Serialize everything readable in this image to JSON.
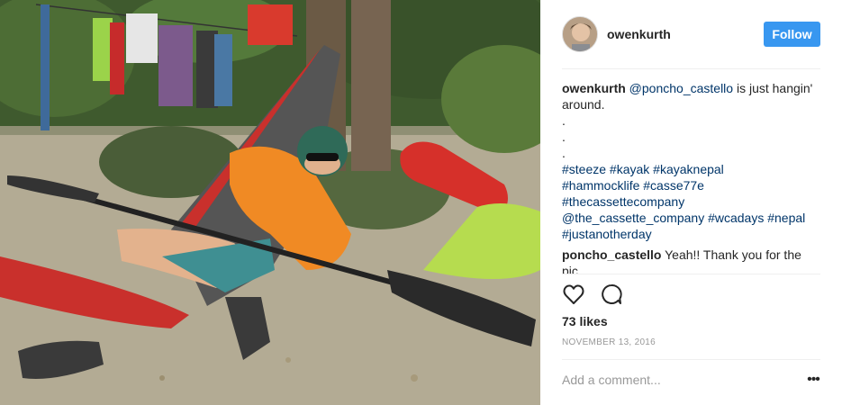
{
  "photo": {
    "description_icon": "photo-hammock-kayaker"
  },
  "header": {
    "username": "owenkurth",
    "follow_label": "Follow"
  },
  "caption": {
    "username": "owenkurth",
    "mention": "@poncho_castello",
    "text": " is just hangin' around.",
    "dots": [
      ".",
      ".",
      "."
    ],
    "hashtag_lines": [
      "#steeze #kayak #kayaknepal",
      "#hammocklife #casse77e",
      "#thecassettecompany",
      "@the_cassette_company #wcadays #nepal",
      "#justanotherday"
    ]
  },
  "reply": {
    "username": "poncho_castello",
    "text": "Yeah!! Thank you for the pic"
  },
  "actions": {
    "like_icon": "heart-icon",
    "comment_icon": "comment-icon"
  },
  "likes": "73 likes",
  "date": "NOVEMBER 13, 2016",
  "add_comment": {
    "placeholder": "Add a comment..."
  },
  "more_label": "•••",
  "colors": {
    "follow_button": "#3897f0",
    "link": "#003569",
    "muted": "#999999",
    "divider": "#efefef"
  }
}
